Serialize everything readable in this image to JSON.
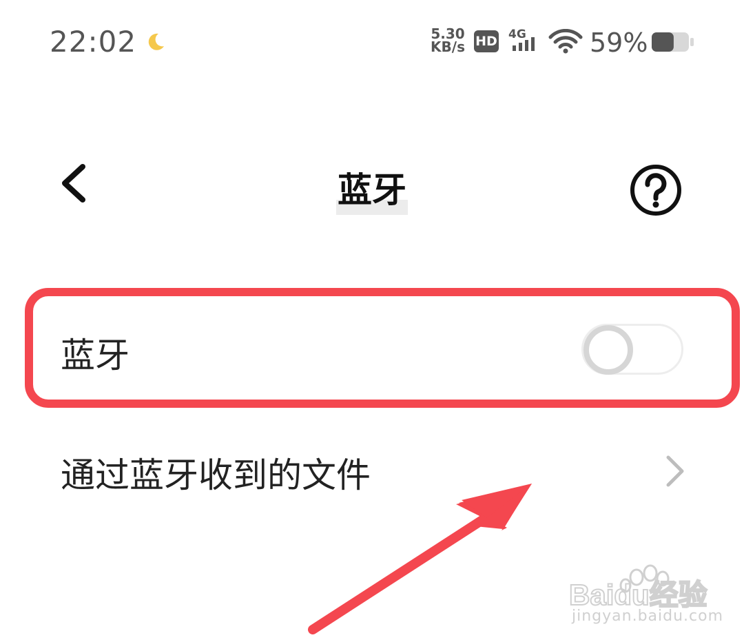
{
  "status_bar": {
    "time": "22:02",
    "net_speed_value": "5.30",
    "net_speed_unit": "KB/s",
    "hd_label": "HD",
    "network_type": "4G",
    "battery_percent": "59%",
    "battery_level": 0.59
  },
  "header": {
    "title": "蓝牙",
    "back_icon": "chevron-left-icon",
    "help_icon": "question-circle-icon"
  },
  "settings": {
    "bluetooth_label": "蓝牙",
    "bluetooth_enabled": false,
    "received_files_label": "通过蓝牙收到的文件"
  },
  "colors": {
    "highlight": "#f4474f",
    "arrow": "#f4474f"
  },
  "watermark": {
    "logo_text": "Baidu经验",
    "url": "jingyan.baidu.com"
  }
}
